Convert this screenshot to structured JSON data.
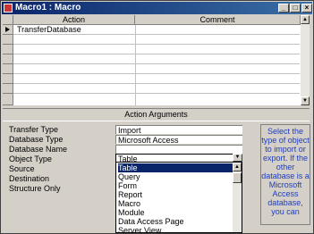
{
  "window": {
    "title": "Macro1 : Macro"
  },
  "grid": {
    "headers": {
      "action": "Action",
      "comment": "Comment"
    },
    "rows": [
      {
        "action": "TransferDatabase",
        "comment": ""
      }
    ]
  },
  "args": {
    "title": "Action Arguments",
    "labels": [
      "Transfer Type",
      "Database Type",
      "Database Name",
      "Object Type",
      "Source",
      "Destination",
      "Structure Only"
    ],
    "transfer_type": "Import",
    "database_type": "Microsoft Access",
    "database_name": "",
    "object_type": "Table",
    "help": "Select the type of object to import or export. If the other database is a Microsoft Access database, you can"
  },
  "dropdown": {
    "options": [
      "Table",
      "Query",
      "Form",
      "Report",
      "Macro",
      "Module",
      "Data Access Page",
      "Server View"
    ],
    "selected": "Table"
  }
}
